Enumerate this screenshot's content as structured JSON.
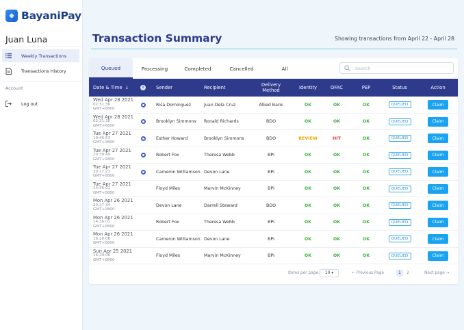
{
  "brand": {
    "name": "BayaniPay"
  },
  "user": {
    "name": "Juan Luna"
  },
  "sidebar": {
    "items": [
      {
        "label": "Weekly Transactions",
        "icon": "list-icon",
        "active": true
      },
      {
        "label": "Transactions History",
        "icon": "document-icon",
        "active": false
      }
    ],
    "section_label": "Account",
    "logout_label": "Log out"
  },
  "main": {
    "title": "Transaction Summary",
    "date_range": "Showing transactions from April 22 - April 28"
  },
  "tabs": [
    {
      "label": "Queued",
      "active": true
    },
    {
      "label": "Processing",
      "active": false
    },
    {
      "label": "Completed",
      "active": false
    },
    {
      "label": "Cancelled",
      "active": false
    },
    {
      "label": "All",
      "active": false
    }
  ],
  "search": {
    "placeholder": "Search",
    "value": ""
  },
  "table": {
    "headers": {
      "date": "Date & Time",
      "sort_arrow": "↓",
      "flag": "i",
      "sender": "Sender",
      "recipient": "Recipient",
      "delivery": "Delivery Method",
      "identity": "Identity",
      "ofac": "OFAC",
      "pep": "PEP",
      "status": "Status",
      "action": "Action"
    },
    "rows": [
      {
        "date": "Wed Apr 28 2021",
        "time": "02:31:30",
        "tz": "GMT+0800",
        "flag": true,
        "sender": "Risa Dominguez",
        "recipient": "Juan Dela Cruz",
        "delivery": "Allied Bank",
        "identity": "OK",
        "ofac": "OK",
        "pep": "OK",
        "status": "QUEUED",
        "action": "Claim"
      },
      {
        "date": "Wed Apr 28 2021",
        "time": "02:31:30",
        "tz": "GMT+0800",
        "flag": true,
        "sender": "Brooklyn Simmons",
        "recipient": "Ronald Richards",
        "delivery": "BDO",
        "identity": "OK",
        "ofac": "OK",
        "pep": "OK",
        "status": "QUEUED",
        "action": "Claim"
      },
      {
        "date": "Tue Apr 27 2021",
        "time": "19:46:53",
        "tz": "GMT+0800",
        "flag": true,
        "sender": "Esther Howard",
        "recipient": "Brooklyn Simmons",
        "delivery": "BDO",
        "identity": "REVIEW",
        "ofac": "HIT",
        "pep": "OK",
        "status": "QUEUED",
        "action": "Claim"
      },
      {
        "date": "Tue Apr 27 2021",
        "time": "20:39:49",
        "tz": "GMT+0800",
        "flag": true,
        "sender": "Robert Fox",
        "recipient": "Theresa Webb",
        "delivery": "BPI",
        "identity": "OK",
        "ofac": "OK",
        "pep": "OK",
        "status": "QUEUED",
        "action": "Claim"
      },
      {
        "date": "Tue Apr 27 2021",
        "time": "20:17:23",
        "tz": "GMT+0800",
        "flag": true,
        "sender": "Cameron Williamson",
        "recipient": "Devon Lane",
        "delivery": "BPI",
        "identity": "OK",
        "ofac": "OK",
        "pep": "OK",
        "status": "QUEUED",
        "action": "Claim"
      },
      {
        "date": "Tue Apr 27 2021",
        "time": "14:36:01",
        "tz": "GMT+0800",
        "flag": false,
        "sender": "Floyd Miles",
        "recipient": "Marvin McKinney",
        "delivery": "BPI",
        "identity": "OK",
        "ofac": "OK",
        "pep": "OK",
        "status": "QUEUED",
        "action": "Claim"
      },
      {
        "date": "Mon Apr 26 2021",
        "time": "20:27:34",
        "tz": "GMT+0800",
        "flag": false,
        "sender": "Devon Lane",
        "recipient": "Darrell Steward",
        "delivery": "BDO",
        "identity": "OK",
        "ofac": "OK",
        "pep": "OK",
        "status": "QUEUED",
        "action": "Claim"
      },
      {
        "date": "Mon Apr 26 2021",
        "time": "14:36:01",
        "tz": "GMT+0800",
        "flag": false,
        "sender": "Robert Fox",
        "recipient": "Theresa Webb",
        "delivery": "BPI",
        "identity": "OK",
        "ofac": "OK",
        "pep": "OK",
        "status": "QUEUED",
        "action": "Claim"
      },
      {
        "date": "Mon Apr 26 2021",
        "time": "16:29:06",
        "tz": "GMT+0800",
        "flag": false,
        "sender": "Cameron Williamson",
        "recipient": "Devon Lane",
        "delivery": "BPI",
        "identity": "OK",
        "ofac": "OK",
        "pep": "OK",
        "status": "QUEUED",
        "action": "Claim"
      },
      {
        "date": "Sun Apr 25 2021",
        "time": "16:29:06",
        "tz": "GMT+0800",
        "flag": false,
        "sender": "Floyd Miles",
        "recipient": "Marvin McKinney",
        "delivery": "BPI",
        "identity": "OK",
        "ofac": "OK",
        "pep": "OK",
        "status": "QUEUED",
        "action": "Claim"
      }
    ]
  },
  "pagination": {
    "items_per_page_label": "Items per page:",
    "items_per_page_value": "10 ▾",
    "previous_label": "← Previous Page",
    "pages": [
      "1",
      "2"
    ],
    "current_page": "1",
    "next_label": "Next page →"
  },
  "colors": {
    "primary": "#2e3a8c",
    "accent": "#1aa3f0",
    "ok": "#3cb23c",
    "hit": "#e53935",
    "review": "#f0a500",
    "background": "#eef5fb"
  }
}
